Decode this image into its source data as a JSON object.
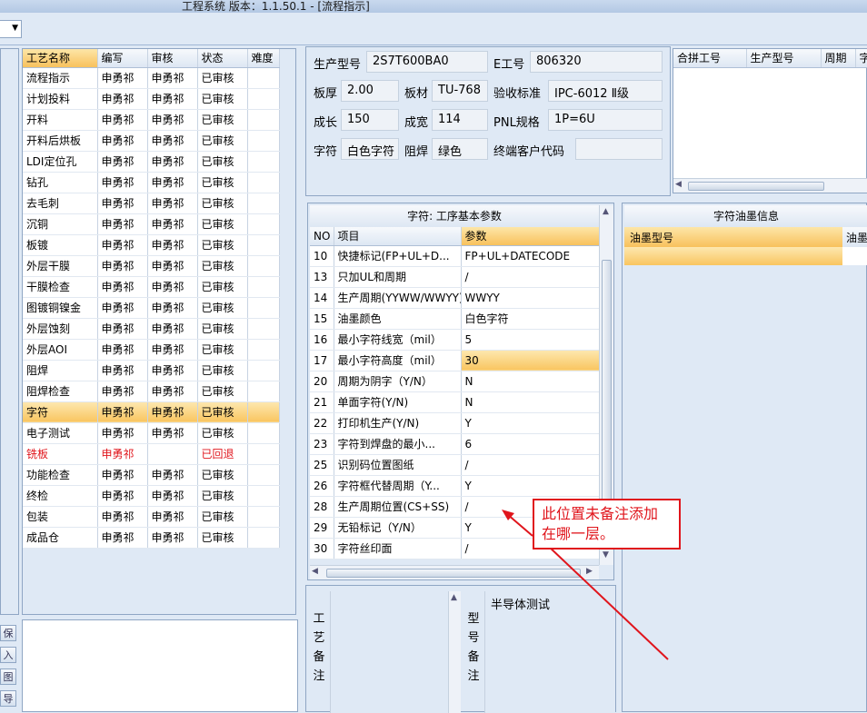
{
  "window": {
    "title": "工程系统  版本：1.1.50.1 - [流程指示]"
  },
  "process_table": {
    "columns": [
      "工艺名称",
      "编写",
      "审核",
      "状态",
      "难度"
    ],
    "rows": [
      [
        "流程指示",
        "申勇祁",
        "申勇祁",
        "已审核",
        ""
      ],
      [
        "计划投料",
        "申勇祁",
        "申勇祁",
        "已审核",
        ""
      ],
      [
        "开料",
        "申勇祁",
        "申勇祁",
        "已审核",
        ""
      ],
      [
        "开料后烘板",
        "申勇祁",
        "申勇祁",
        "已审核",
        ""
      ],
      [
        "LDI定位孔",
        "申勇祁",
        "申勇祁",
        "已审核",
        ""
      ],
      [
        "钻孔",
        "申勇祁",
        "申勇祁",
        "已审核",
        ""
      ],
      [
        "去毛刺",
        "申勇祁",
        "申勇祁",
        "已审核",
        ""
      ],
      [
        "沉铜",
        "申勇祁",
        "申勇祁",
        "已审核",
        ""
      ],
      [
        "板镀",
        "申勇祁",
        "申勇祁",
        "已审核",
        ""
      ],
      [
        "外层干膜",
        "申勇祁",
        "申勇祁",
        "已审核",
        ""
      ],
      [
        "干膜检查",
        "申勇祁",
        "申勇祁",
        "已审核",
        ""
      ],
      [
        "图镀铜镍金",
        "申勇祁",
        "申勇祁",
        "已审核",
        ""
      ],
      [
        "外层蚀刻",
        "申勇祁",
        "申勇祁",
        "已审核",
        ""
      ],
      [
        "外层AOI",
        "申勇祁",
        "申勇祁",
        "已审核",
        ""
      ],
      [
        "阻焊",
        "申勇祁",
        "申勇祁",
        "已审核",
        ""
      ],
      [
        "阻焊检查",
        "申勇祁",
        "申勇祁",
        "已审核",
        ""
      ],
      [
        "字符",
        "申勇祁",
        "申勇祁",
        "已审核",
        ""
      ],
      [
        "电子测试",
        "申勇祁",
        "申勇祁",
        "已审核",
        ""
      ],
      [
        "铣板",
        "申勇祁",
        "",
        "已回退",
        ""
      ],
      [
        "功能检查",
        "申勇祁",
        "申勇祁",
        "已审核",
        ""
      ],
      [
        "终检",
        "申勇祁",
        "申勇祁",
        "已审核",
        ""
      ],
      [
        "包装",
        "申勇祁",
        "申勇祁",
        "已审核",
        ""
      ],
      [
        "成品仓",
        "申勇祁",
        "申勇祁",
        "已审核",
        ""
      ]
    ],
    "selected_index": 16,
    "rejected_index": 18
  },
  "left_buttons": [
    "保",
    "入",
    "图",
    "导"
  ],
  "info": {
    "model_label": "生产型号",
    "model_value": "2S7T600BA0",
    "eno_label": "E工号",
    "eno_value": "806320",
    "thickness_label": "板厚",
    "thickness_value": "2.00",
    "material_label": "板材",
    "material_value": "TU-768",
    "standard_label": "验收标准",
    "standard_value": "IPC-6012 Ⅱ级",
    "length_label": "成长",
    "length_value": "150",
    "width_label": "成宽",
    "width_value": "114",
    "pnl_label": "PNL规格",
    "pnl_value": "1P=6U",
    "char_label": "字符",
    "char_value": "白色字符",
    "mask_label": "阻焊",
    "mask_value": "绿色",
    "customer_label": "终端客户代码",
    "customer_value": ""
  },
  "merge_table": {
    "columns": [
      "合拼工号",
      "生产型号",
      "周期",
      "字"
    ]
  },
  "params": {
    "title": "字符: 工序基本参数",
    "columns": [
      "NO",
      "项目",
      "参数"
    ],
    "rows": [
      [
        "10",
        "快捷标记(FP+UL+D...",
        "FP+UL+DATECODE"
      ],
      [
        "13",
        "只加UL和周期",
        "/"
      ],
      [
        "14",
        "生产周期(YYWW/WWYY)",
        "WWYY"
      ],
      [
        "15",
        "油墨颜色",
        "白色字符"
      ],
      [
        "16",
        "最小字符线宽（mil）",
        "5"
      ],
      [
        "17",
        "最小字符高度（mil）",
        "30"
      ],
      [
        "20",
        "周期为阴字（Y/N）",
        "N"
      ],
      [
        "21",
        "单面字符(Y/N)",
        "N"
      ],
      [
        "22",
        "打印机生产(Y/N)",
        "Y"
      ],
      [
        "23",
        "字符到焊盘的最小...",
        "6"
      ],
      [
        "25",
        "识别码位置图纸",
        "/"
      ],
      [
        "26",
        "字符框代替周期（Y...",
        "Y"
      ],
      [
        "28",
        "生产周期位置(CS+SS)",
        "/"
      ],
      [
        "29",
        "无铅标记（Y/N）",
        "Y"
      ],
      [
        "30",
        "字符丝印面",
        "/"
      ]
    ],
    "selected_index": 5
  },
  "ink": {
    "title": "字符油墨信息",
    "columns": [
      "油墨型号",
      "油墨"
    ]
  },
  "remarks": {
    "process_label": "工艺备注",
    "model_label": "型号备注",
    "model_value": "半导体测试"
  },
  "callout": {
    "text": "此位置未备注添加在哪一层。",
    "color": "#e0151c"
  }
}
